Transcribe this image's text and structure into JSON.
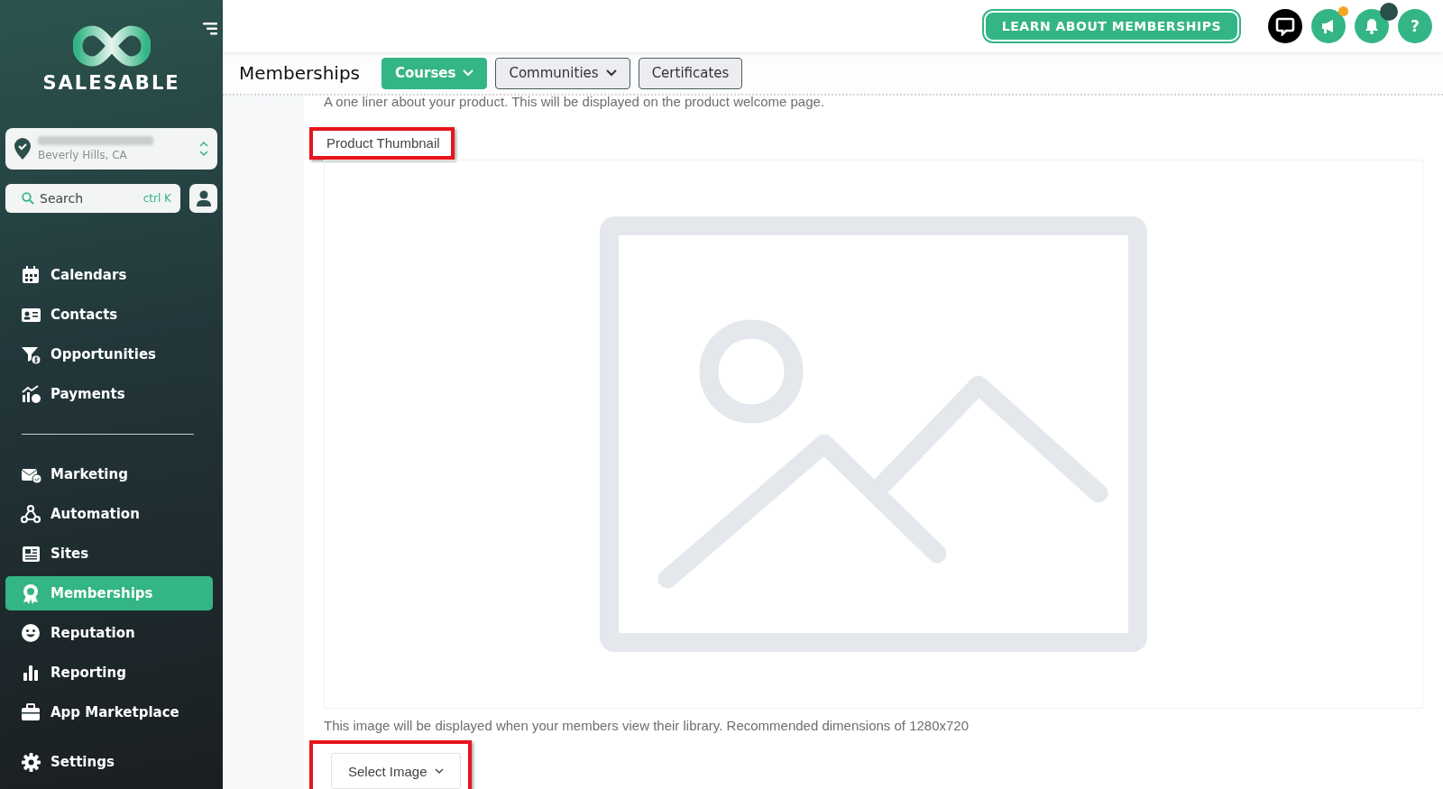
{
  "sidebar": {
    "brand": "SALESABLE",
    "location": {
      "address": "Beverly Hills, CA"
    },
    "search": {
      "placeholder": "Search",
      "shortcut": "ctrl K"
    },
    "nav_groups": [
      [
        {
          "label": "Calendars",
          "selected": false
        },
        {
          "label": "Contacts",
          "selected": false
        },
        {
          "label": "Opportunities",
          "selected": false
        },
        {
          "label": "Payments",
          "selected": false
        }
      ],
      [
        {
          "label": "Marketing",
          "selected": false
        },
        {
          "label": "Automation",
          "selected": false
        },
        {
          "label": "Sites",
          "selected": false
        },
        {
          "label": "Memberships",
          "selected": true
        },
        {
          "label": "Reputation",
          "selected": false
        },
        {
          "label": "Reporting",
          "selected": false
        },
        {
          "label": "App Marketplace",
          "selected": false
        }
      ]
    ],
    "footer_item": {
      "label": "Settings"
    }
  },
  "topbar": {
    "cta": "LEARN ABOUT MEMBERSHIPS",
    "icon_buttons": [
      {
        "kind": "chat"
      },
      {
        "kind": "announce",
        "color": "#f5a623"
      },
      {
        "kind": "bell",
        "color": "#2b4f4a"
      },
      {
        "kind": "help",
        "label": "?"
      }
    ]
  },
  "header": {
    "title": "Memberships",
    "tabs": [
      {
        "label": "Courses",
        "kind": "dropdown",
        "selected": true
      },
      {
        "label": "Communities",
        "kind": "dropdown",
        "selected": false
      },
      {
        "label": "Certificates",
        "kind": "link",
        "selected": false
      }
    ]
  },
  "form": {
    "intro_hint": "A one liner about your product. This will be displayed on the product welcome page.",
    "thumbnail": {
      "label": "Product Thumbnail",
      "label_highlighted": true,
      "hint": "This image will be displayed when your members view their library. Recommended dimensions of 1280x720",
      "select_button": "Select Image",
      "button_highlighted": true
    }
  }
}
